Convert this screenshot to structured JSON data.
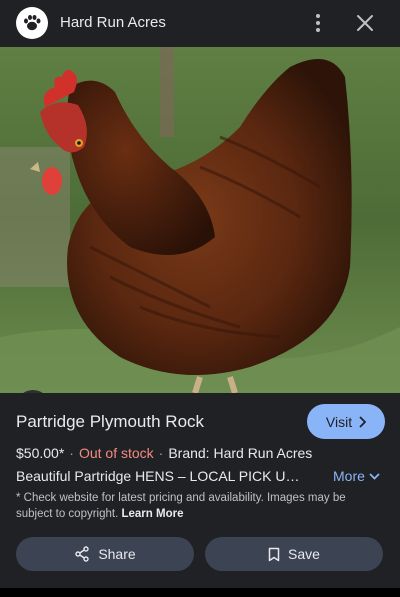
{
  "header": {
    "site_name": "Hard Run Acres",
    "logo_icon": "paw-icon",
    "menu_icon": "more-vert-icon",
    "close_icon": "close-icon"
  },
  "image": {
    "alt": "Partridge Plymouth Rock",
    "lens_icon": "lens-icon"
  },
  "product": {
    "title": "Partridge Plymouth Rock",
    "visit_label": "Visit",
    "price": "$50.00*",
    "stock": "Out of stock",
    "brand": "Brand: Hard Run Acres",
    "description": "Beautiful Partridge HENS – LOCAL PICK UP!,...",
    "more_label": "More",
    "disclaimer": "* Check website for latest pricing and availability. Images may be subject to copyright.",
    "learn_more": "Learn More"
  },
  "actions": {
    "share_label": "Share",
    "save_label": "Save"
  },
  "colors": {
    "background": "#202124",
    "accent": "#8ab4f8",
    "out_of_stock": "#f28b82",
    "button_bg": "#3c4453"
  }
}
